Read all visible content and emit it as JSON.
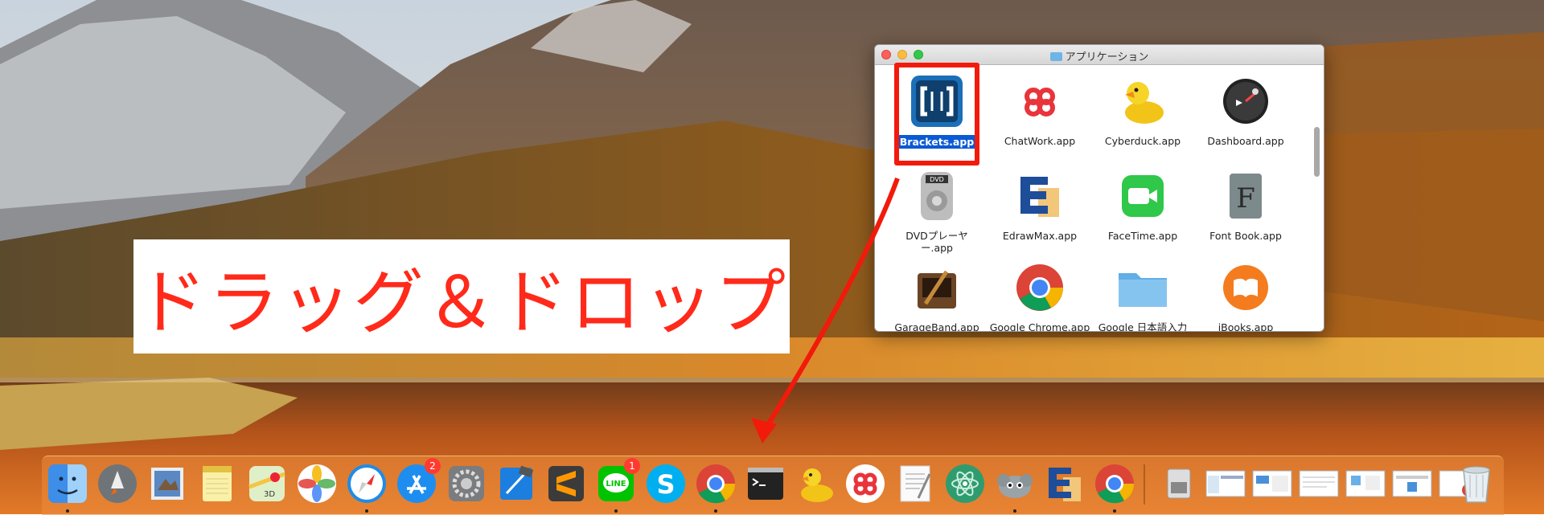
{
  "finder": {
    "title": "アプリケーション",
    "apps": [
      {
        "label": "Brackets.app",
        "icon": "brackets-icon",
        "selected": true
      },
      {
        "label": "ChatWork.app",
        "icon": "chatwork-icon"
      },
      {
        "label": "Cyberduck.app",
        "icon": "cyberduck-icon"
      },
      {
        "label": "Dashboard.app",
        "icon": "dashboard-icon"
      },
      {
        "label": "DVDプレーヤ\nー.app",
        "icon": "dvd-player-icon"
      },
      {
        "label": "EdrawMax.app",
        "icon": "edrawmax-icon"
      },
      {
        "label": "FaceTime.app",
        "icon": "facetime-icon"
      },
      {
        "label": "Font Book.app",
        "icon": "font-book-icon"
      },
      {
        "label": "GarageBand.app",
        "icon": "garageband-icon"
      },
      {
        "label": "Google Chrome.app",
        "icon": "chrome-icon"
      },
      {
        "label": "Google 日本語入力",
        "icon": "folder-icon"
      },
      {
        "label": "iBooks.app",
        "icon": "ibooks-icon"
      }
    ]
  },
  "caption": {
    "text": "ドラッグ＆ドロップ"
  },
  "dock": {
    "items": [
      {
        "name": "finder",
        "running": true
      },
      {
        "name": "launchpad"
      },
      {
        "name": "mail"
      },
      {
        "name": "notes"
      },
      {
        "name": "maps"
      },
      {
        "name": "photos"
      },
      {
        "name": "safari",
        "running": true
      },
      {
        "name": "app-store",
        "badge": "2"
      },
      {
        "name": "system-preferences"
      },
      {
        "name": "xcode"
      },
      {
        "name": "sublime-text"
      },
      {
        "name": "line",
        "badge": "1",
        "running": true
      },
      {
        "name": "skype"
      },
      {
        "name": "chrome",
        "running": true
      },
      {
        "name": "terminal"
      },
      {
        "name": "cyberduck"
      },
      {
        "name": "chatwork"
      },
      {
        "name": "textedit"
      },
      {
        "name": "atom"
      },
      {
        "name": "sequel-pro",
        "running": true
      },
      {
        "name": "edrawmax"
      },
      {
        "name": "chrome-2",
        "running": true
      }
    ],
    "right_items": [
      "downloads-stack",
      "window-1",
      "window-2",
      "window-3",
      "window-4",
      "window-5",
      "window-6",
      "trash"
    ]
  },
  "colors": {
    "accent_red": "#f21a0a",
    "selection_blue": "#0a5ad4"
  }
}
